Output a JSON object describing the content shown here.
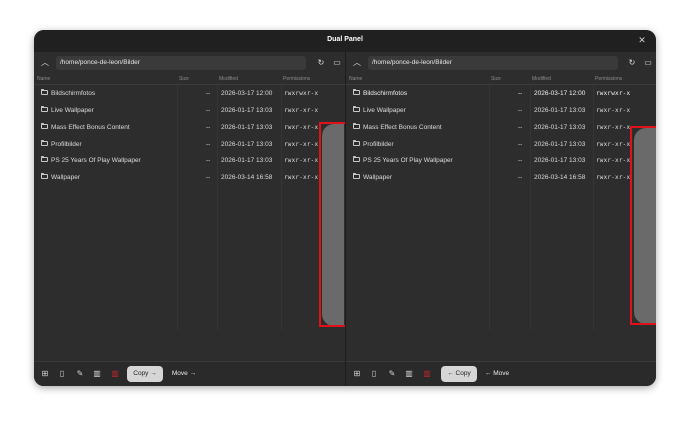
{
  "window": {
    "title": "Dual Panel",
    "close_label": "✕"
  },
  "columns": {
    "name": "Name",
    "size": "Size",
    "modified": "Modified",
    "permissions": "Permissions"
  },
  "left": {
    "path": "/home/ponce-de-leon/Bilder",
    "files": [
      {
        "name": "Bildschirmfotos",
        "size": "--",
        "modified": "2026-03-17 12:00",
        "perm": "rwxrwxr-x"
      },
      {
        "name": "Live Wallpaper",
        "size": "--",
        "modified": "2026-01-17 13:03",
        "perm": "rwxr-xr-x"
      },
      {
        "name": "Mass Effect Bonus Content",
        "size": "--",
        "modified": "2026-01-17 13:03",
        "perm": "rwxr-xr-x"
      },
      {
        "name": "Profilbilder",
        "size": "--",
        "modified": "2026-01-17 13:03",
        "perm": "rwxr-xr-x"
      },
      {
        "name": "PS 25 Years Of Play Wallpaper",
        "size": "--",
        "modified": "2026-01-17 13:03",
        "perm": "rwxr-xr-x"
      },
      {
        "name": "Wallpaper",
        "size": "--",
        "modified": "2026-03-14 16:58",
        "perm": "rwxr-xr-x"
      }
    ],
    "copy_label": "Copy →",
    "move_label": "Move →"
  },
  "right": {
    "path": "/home/ponce-de-leon/Bilder",
    "files": [
      {
        "name": "Bildschirmfotos",
        "size": "--",
        "modified": "2026-03-17 12:00",
        "perm": "rwxrwxr-x"
      },
      {
        "name": "Live Wallpaper",
        "size": "--",
        "modified": "2026-01-17 13:03",
        "perm": "rwxr-xr-x"
      },
      {
        "name": "Mass Effect Bonus Content",
        "size": "--",
        "modified": "2026-01-17 13:03",
        "perm": "rwxr-xr-x"
      },
      {
        "name": "Profilbilder",
        "size": "--",
        "modified": "2026-01-17 13:03",
        "perm": "rwxr-xr-x"
      },
      {
        "name": "PS 25 Years Of Play Wallpaper",
        "size": "--",
        "modified": "2026-01-17 13:03",
        "perm": "rwxr-xr-x"
      },
      {
        "name": "Wallpaper",
        "size": "--",
        "modified": "2026-03-14 16:58",
        "perm": "rwxr-xr-x"
      }
    ],
    "copy_label": "← Copy",
    "move_label": "← Move"
  },
  "icons": {
    "up": "chevron-up-icon",
    "refresh": "refresh-icon",
    "terminal": "terminal-icon",
    "new_folder": "new-folder-icon",
    "new_file": "new-file-icon",
    "rename": "rename-icon",
    "trash": "trash-icon",
    "delete": "delete-red-icon"
  },
  "colors": {
    "highlight": "#e0111b",
    "delete": "#c0262a"
  }
}
